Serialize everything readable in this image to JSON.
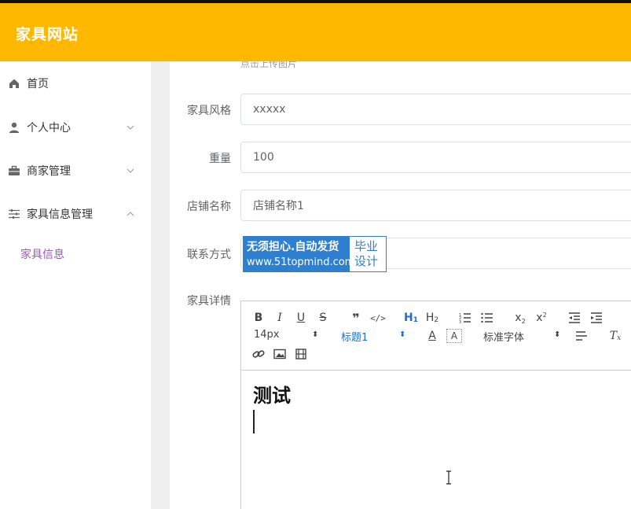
{
  "app": {
    "title": "家具网站"
  },
  "sidebar": {
    "items": [
      {
        "label": "首页",
        "icon": "home-icon"
      },
      {
        "label": "个人中心",
        "icon": "user-icon",
        "arrow": "chevron-down-icon"
      },
      {
        "label": "商家管理",
        "icon": "briefcase-icon",
        "arrow": "chevron-down-icon"
      },
      {
        "label": "家具信息管理",
        "icon": "sliders-icon",
        "arrow": "chevron-up-icon"
      }
    ],
    "subitems": [
      {
        "label": "家具信息"
      }
    ]
  },
  "form": {
    "upload_hint": "点击上传图片",
    "fields": [
      {
        "label": "家具风格",
        "value": "xxxxx"
      },
      {
        "label": "重量",
        "value": "100"
      },
      {
        "label": "店铺名称",
        "value": "店铺名称1"
      },
      {
        "label": "联系方式",
        "value": ""
      }
    ],
    "details_label": "家具详情"
  },
  "watermark": {
    "line1": "无须担心.自动发货",
    "line2": "www.51topmind.com",
    "side1": "毕业",
    "side2": "设计"
  },
  "editor": {
    "font_size": "14px",
    "heading": "标题1",
    "font_family": "标准字体",
    "content_heading": "测试"
  },
  "colors": {
    "header": "#ffb800",
    "accent": "#9b59b6",
    "watermark": "#2f7fd1"
  }
}
